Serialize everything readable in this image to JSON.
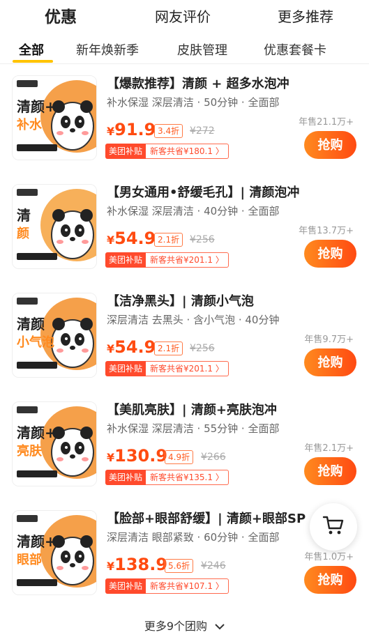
{
  "top_tabs": [
    "优惠",
    "网友评价",
    "更多推荐"
  ],
  "sub_tabs": [
    "全部",
    "新年焕新季",
    "皮肤管理",
    "优惠套餐卡"
  ],
  "deals": [
    {
      "title": "【爆款推荐】清颜 + 超多水泡冲",
      "desc": "补水保湿 深层清洁 · 50分钟 · 全面部",
      "sold": "年售21.1万+",
      "currency": "¥",
      "price": "91.9",
      "discount": "3.4折",
      "original": "¥272",
      "badge": "美团补贴",
      "save": "新客共省¥180.1 〉",
      "buy": "抢购",
      "thumb_line1": "清颜+",
      "thumb_line2": "补水"
    },
    {
      "title": "【男女通用•舒缓毛孔】| 清颜泡冲",
      "desc": "补水保湿 深层清洁 · 40分钟 · 全面部",
      "sold": "年售13.7万+",
      "currency": "¥",
      "price": "54.9",
      "discount": "2.1折",
      "original": "¥256",
      "badge": "美团补贴",
      "save": "新客共省¥201.1 〉",
      "buy": "抢购",
      "thumb_line1": "清",
      "thumb_line2": "颜"
    },
    {
      "title": "【洁净黑头】|  清颜小气泡",
      "desc": "深层清洁 去黑头 · 含小气泡 · 40分钟",
      "sold": "年售9.7万+",
      "currency": "¥",
      "price": "54.9",
      "discount": "2.1折",
      "original": "¥256",
      "badge": "美团补贴",
      "save": "新客共省¥201.1 〉",
      "buy": "抢购",
      "thumb_line1": "清颜",
      "thumb_line2": "小气泡"
    },
    {
      "title": "【美肌亮肤】|  清颜+亮肤泡冲",
      "desc": "补水保湿 深层清洁 · 55分钟 · 全面部",
      "sold": "年售2.1万+",
      "currency": "¥",
      "price": "130.9",
      "discount": "4.9折",
      "original": "¥266",
      "badge": "美团补贴",
      "save": "新客共省¥135.1 〉",
      "buy": "抢购",
      "thumb_line1": "清颜+",
      "thumb_line2": "亮肤"
    },
    {
      "title": "【脸部+眼部舒缓】|  清颜+眼部SP",
      "desc": "深层清洁 眼部紧致 · 60分钟 · 全面部",
      "sold": "年售1.0万+",
      "currency": "¥",
      "price": "138.9",
      "discount": "5.6折",
      "original": "¥246",
      "badge": "美团补贴",
      "save": "新客共省¥107.1 〉",
      "buy": "抢购",
      "thumb_line1": "清颜+",
      "thumb_line2": "眼部"
    }
  ],
  "more_label": "更多9个团购",
  "colors": {
    "accent": "#ffc300",
    "price": "#ff4b10",
    "button": "#ff5a12"
  },
  "icons": {
    "cart": "cart-icon",
    "chevron": "chevron-down-icon"
  }
}
